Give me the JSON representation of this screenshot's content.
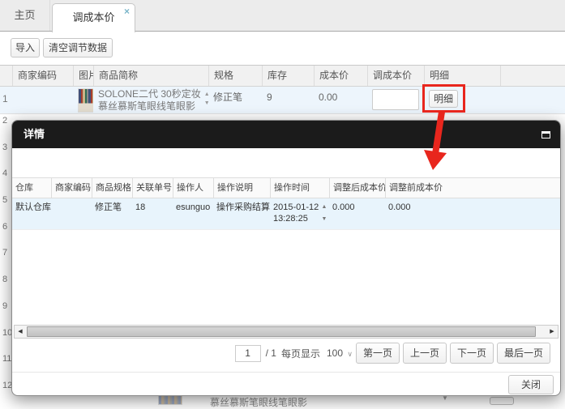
{
  "icons": {
    "close": "×",
    "sort_up": "▲",
    "sort_down": "▼",
    "spinner_up": "▲",
    "spinner_down": "▼",
    "dropdown": "∨",
    "scroll_left": "◀",
    "scroll_right": "▶"
  },
  "colors": {
    "accent_red": "#e8261d",
    "titlebar_bg": "#1b1b1b",
    "row_highlight": "#e8f4fc",
    "tab_close": "#7ab5c9"
  },
  "tabs": {
    "home": "主页",
    "current": "调成本价"
  },
  "toolbar": {
    "import": "导入",
    "clear": "清空调节数据"
  },
  "main_table": {
    "headers": [
      "商家编码",
      "图片",
      "商品简称",
      "规格",
      "库存",
      "成本价",
      "调成本价",
      "明细"
    ],
    "row1": {
      "index": "1",
      "merchant_code": "",
      "name_line1": "SOLONE二代 30秒定妆",
      "name_line2": "慕丝慕斯笔眼线笔眼影",
      "spec": "修正笔",
      "stock": "9",
      "cost": "0.00",
      "adjust_value": "",
      "detail_button": "明细"
    },
    "row_numbers": [
      "2",
      "3",
      "4",
      "5",
      "6",
      "7",
      "8",
      "9",
      "10",
      "11",
      "12"
    ],
    "bottom_row_text": "慕丝慕斯笔眼线笔眼影"
  },
  "modal": {
    "title": "详情",
    "table": {
      "headers": [
        "仓库",
        "商家编码",
        "商品规格",
        "关联单号",
        "操作人",
        "操作说明",
        "操作时间",
        "调整后成本价",
        "调整前成本价"
      ],
      "row": {
        "warehouse": "默认仓库",
        "merchant_code": "",
        "spec": "修正笔",
        "related_no": "18",
        "operator": "esunguo",
        "operation": "操作采购结算",
        "time_line1": "2015-01-12",
        "time_line2": "13:28:25",
        "cost_after": "0.000",
        "cost_before": "0.000"
      }
    },
    "pagination": {
      "page": "1",
      "page_total": "/ 1",
      "per_page_label": "每页显示",
      "per_page_value": "100",
      "first": "第一页",
      "prev": "上一页",
      "next": "下一页",
      "last": "最后一页"
    },
    "close": "关闭"
  }
}
